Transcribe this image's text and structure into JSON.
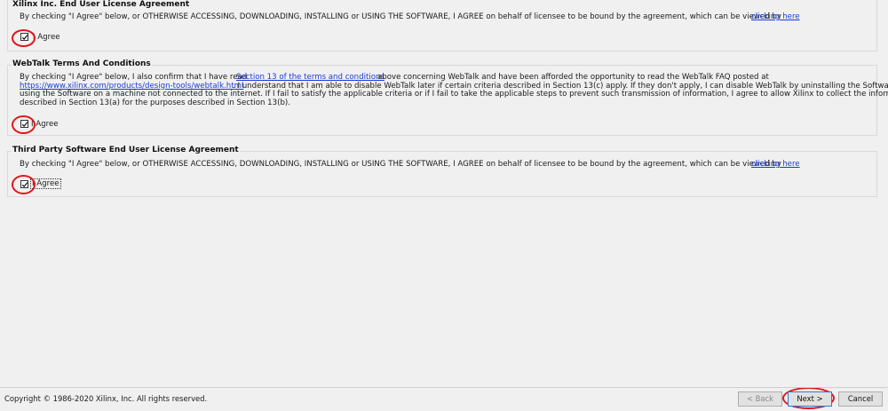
{
  "sections": [
    {
      "title": "Xilinx Inc. End User License Agreement",
      "text_before_link": "By checking \"I Agree\" below, or OTHERWISE ACCESSING, DOWNLOADING, INSTALLING or USING THE SOFTWARE, I AGREE on behalf of licensee to be bound by the agreement, which can be viewed by",
      "link": "clicking here",
      "checkbox_label": "I Agree",
      "checked": true
    },
    {
      "title": "WebTalk Terms And Conditions",
      "line1_before_link": "By checking \"I Agree\" below, I also confirm that I have read",
      "line1_link": "Section 13 of the terms and conditions",
      "line1_after_link": "above concerning WebTalk and have been afforded the opportunity to read the WebTalk FAQ posted at",
      "line2_link": "https://www.xilinx.com/products/design-tools/webtalk.html",
      "line2_after_link": ". I understand that I am able to disable WebTalk later if certain criteria described in Section 13(c) apply. If they don't apply, I can disable WebTalk by uninstalling the Software or",
      "line3": "using the Software on a machine not connected to the internet. If I fail to satisfy the applicable criteria or if I fail to take the applicable steps to prevent such transmission of information, I agree to allow Xilinx to collect the information",
      "line4": "described in Section 13(a) for the purposes described in Section 13(b).",
      "checkbox_label": "I Agree",
      "checked": true
    },
    {
      "title": "Third Party Software End User License Agreement",
      "text_before_link": "By checking \"I Agree\" below, or OTHERWISE ACCESSING, DOWNLOADING, INSTALLING or USING THE SOFTWARE, I AGREE on behalf of licensee to be bound by the agreement, which can be viewed by",
      "link": "clicking here",
      "checkbox_label": "I Agree",
      "checked": true
    }
  ],
  "footer": {
    "copyright": "Copyright © 1986-2020 Xilinx, Inc.  All rights reserved.",
    "back": "< Back",
    "next": "Next >",
    "cancel": "Cancel"
  },
  "annotation_color": "#e0161c"
}
